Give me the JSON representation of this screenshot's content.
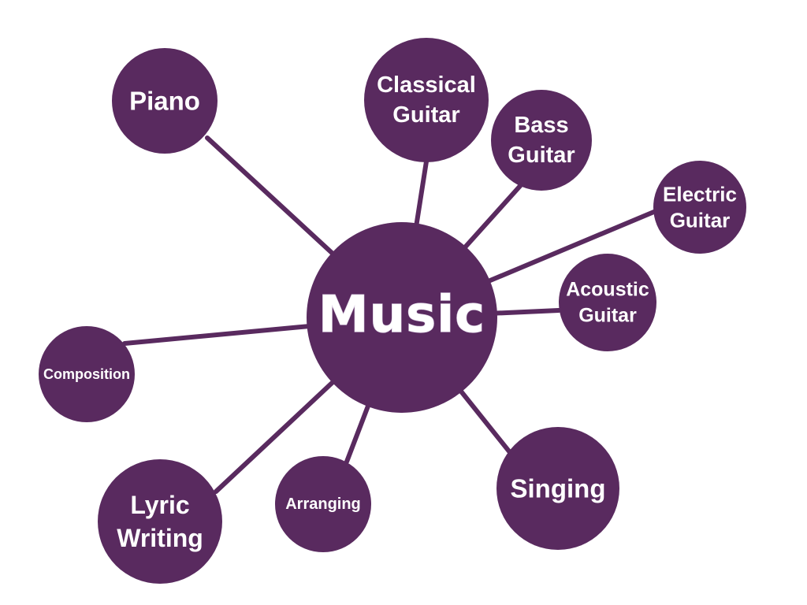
{
  "colors": {
    "node": "#592a5f",
    "line": "#592a5f",
    "text": "#ffffff",
    "background": "#ffffff"
  },
  "center": {
    "label": "Music"
  },
  "branches": [
    {
      "id": "piano",
      "lines": [
        "Piano"
      ]
    },
    {
      "id": "classical-guitar",
      "lines": [
        "Classical",
        "Guitar"
      ]
    },
    {
      "id": "bass-guitar",
      "lines": [
        "Bass",
        "Guitar"
      ]
    },
    {
      "id": "electric-guitar",
      "lines": [
        "Electric",
        "Guitar"
      ]
    },
    {
      "id": "acoustic-guitar",
      "lines": [
        "Acoustic",
        "Guitar"
      ]
    },
    {
      "id": "composition",
      "lines": [
        "Composition"
      ]
    },
    {
      "id": "lyric-writing",
      "lines": [
        "Lyric",
        "Writing"
      ]
    },
    {
      "id": "arranging",
      "lines": [
        "Arranging"
      ]
    },
    {
      "id": "singing",
      "lines": [
        "Singing"
      ]
    }
  ]
}
